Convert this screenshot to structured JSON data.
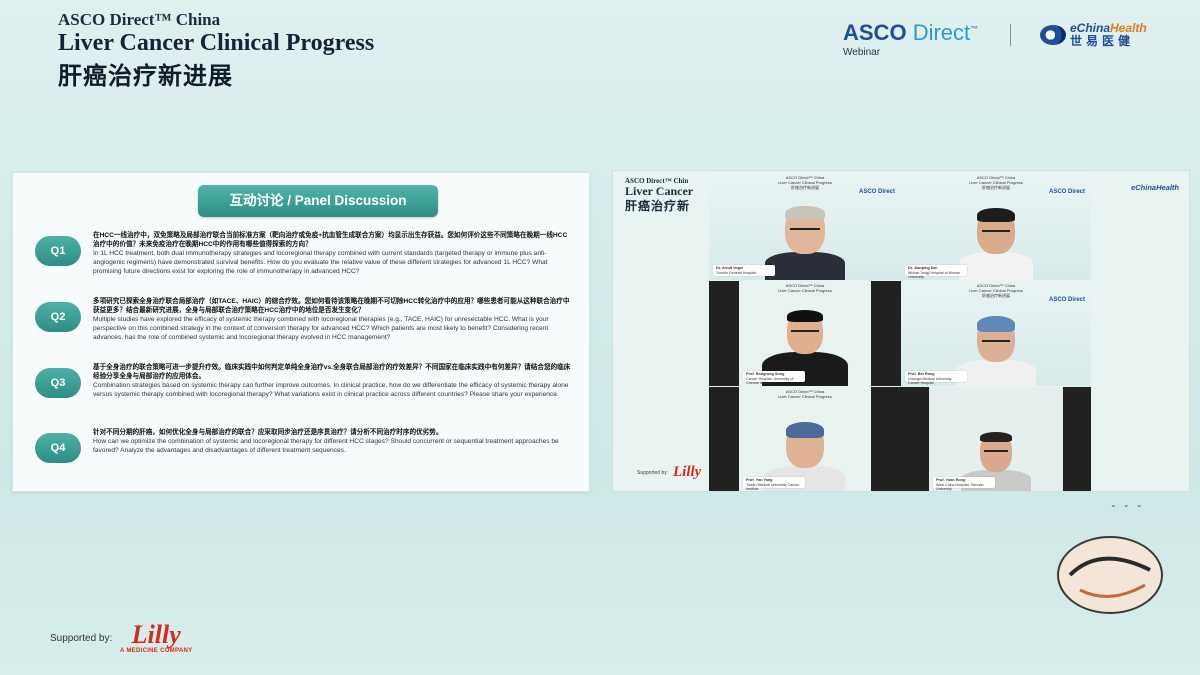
{
  "header": {
    "subtitle": "ASCO Direct™ China",
    "title": "Liver Cancer Clinical Progress",
    "title_cn": "肝癌治疗新进展",
    "asco_logo_main": "ASCO",
    "asco_logo_light": "Direct",
    "asco_tm": "™",
    "asco_caption": "Webinar",
    "echina_en_a": "eChina",
    "echina_en_b": "Health",
    "echina_cn": "世易医健"
  },
  "slide": {
    "title": "互动讨论 / Panel Discussion",
    "questions": [
      {
        "badge": "Q1",
        "cn": "在HCC一线治疗中，双免策略及局部治疗联合当前标准方案（靶向治疗或免疫+抗血管生成联合方案）均显示出生存获益。您如何评价这些不同策略在晚期一线HCC治疗中的价值？未来免疫治疗在晚期HCC中的作用有哪些值得探索的方向？",
        "en": "In 1L HCC treatment, both dual immunotherapy strategies and locoregional therapy combined with current standards (targeted therapy or immune plus anti-angiogenic regimens) have demonstrated survival benefits. How do you evaluate the relative value of these different strategies for advanced 1L HCC? What promising future directions exist for exploring the role of immunotherapy in advanced HCC?"
      },
      {
        "badge": "Q2",
        "cn": "多项研究已探索全身治疗联合局部治疗（如TACE、HAIC）的综合疗效。您如何看待该策略在晚期不可切除HCC转化治疗中的应用？哪些患者可能从这种联合治疗中获益更多？结合最新研究进展，全身与局部联合治疗策略在HCC治疗中的地位是否发生变化？",
        "en": "Multiple studies have explored the efficacy of systemic therapy combined with locoregional therapies (e.g., TACE, HAIC) for unresectable HCC. What is your perspective on this combined strategy in the context of conversion therapy for advanced HCC? Which patients are most likely to benefit? Considering recent advances, has the role of combined systemic and locoregional therapy evolved in HCC management?"
      },
      {
        "badge": "Q3",
        "cn": "基于全身治疗的联合策略可进一步提升疗效。临床实践中如何判定单纯全身治疗vs.全身联合局部治疗的疗效差异？不同国家在临床实践中有何差异？请结合您的临床经验分享全身与局部治疗的应用体会。",
        "en": "Combination strategies based on systemic therapy can further improve outcomes. In clinical practice, how do we differentiate the efficacy of systemic therapy alone versus systemic therapy combined with locoregional therapy? What variations exist in clinical practice across different countries? Please share your experience."
      },
      {
        "badge": "Q4",
        "cn": "针对不同分期的肝癌，如何优化全身与局部治疗的联合？应采取同步治疗还是序贯治疗？请分析不同治疗时序的优劣势。",
        "en": "How can we optimize the combination of systemic and locoregional therapy for different HCC stages? Should concurrent or sequential treatment approaches be favored? Analyze the advantages and disadvantages of different treatment sequences."
      }
    ]
  },
  "video": {
    "bg_title_sub": "ASCO Direct™ Chin",
    "bg_title_main": "Liver Cancer",
    "bg_title_cn": "肝癌治疗新",
    "echina": "eChinaHealth",
    "supported_by": "Supported by:",
    "lilly": "Lilly",
    "tile_header_sub": "ASCO Direct™ China",
    "tile_header_main": "Liver Cancer Clinical Progress",
    "tile_header_cn": "肝癌治疗新进展",
    "tile_asco": "ASCO Direct",
    "participants": [
      {
        "name": "Dr. Arndt Vogel",
        "affil": "Toronto General Hospital"
      },
      {
        "name": "Dr. Jianping Dai",
        "affil": "Wuhan Tongji Hospital of Wuhan University"
      },
      {
        "name": "Prof. Rongrong Song",
        "affil": "Cancer Hospital, University of Chinese Academy"
      },
      {
        "name": "Prof. Bin Rong",
        "affil": "Guangxi Medical University Cancer Hospital"
      },
      {
        "name": "Prof. Yan Yang",
        "affil": "Tianjin Medical University Cancer Institute"
      },
      {
        "name": "Prof. Yuan Rong",
        "affil": "West China Hospital, Sichuan University"
      }
    ]
  },
  "footer": {
    "supported_by": "Supported by:",
    "lilly_word": "Lilly",
    "lilly_tag": "A MEDICINE COMPANY"
  }
}
